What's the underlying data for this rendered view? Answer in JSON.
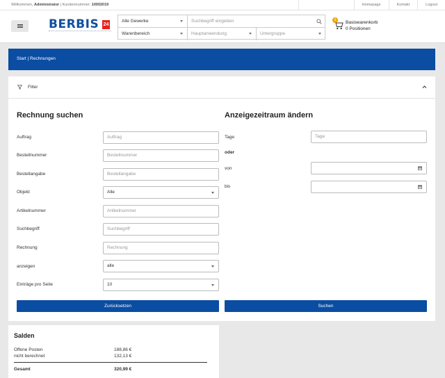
{
  "topbar": {
    "welcome_prefix": "Willkommen,",
    "user": "Administrator",
    "customer_label": "| Kundennummer:",
    "customer_no": "10002019",
    "links": [
      "Homepage",
      "Kontakt",
      "Logout"
    ]
  },
  "header": {
    "logo_text": "BERBIS",
    "logo_badge": "24",
    "search": {
      "trade_select": "Alle Gewerke",
      "search_placeholder": "Suchbegriff eingeben",
      "area_select": "Warenbereich",
      "main_use_select": "Hauptanwendung",
      "subgroup_select": "Untergruppe"
    },
    "cart": {
      "badge": "0",
      "title": "Basiswarenkorb",
      "count": "0 Positionen"
    }
  },
  "breadcrumb": "Start | Rechnungen",
  "filter": {
    "label": "Filter",
    "search_section_title": "Rechnung suchen",
    "period_section_title": "Anzeigezeitraum ändern",
    "fields": [
      {
        "label": "Auftrag",
        "placeholder": "Auftrag",
        "type": "text"
      },
      {
        "label": "Bestellnummer",
        "placeholder": "Bestellnummer",
        "type": "text"
      },
      {
        "label": "Bestellangabe",
        "placeholder": "Bestellangabe",
        "type": "text"
      },
      {
        "label": "Objekt",
        "value": "Alle",
        "type": "select"
      },
      {
        "label": "Artikelnummer",
        "placeholder": "Artikelnummer",
        "type": "text"
      },
      {
        "label": "Suchbegriff",
        "placeholder": "Suchbegriff",
        "type": "text"
      },
      {
        "label": "Rechnung",
        "placeholder": "Rechnung",
        "type": "text"
      },
      {
        "label": "anzeigen",
        "value": "alle",
        "type": "select"
      },
      {
        "label": "Einträge pro Seite",
        "value": "10",
        "type": "select"
      }
    ],
    "period": {
      "days_label": "Tage",
      "days_placeholder": "Tage",
      "or_label": "oder",
      "from_label": "von",
      "to_label": "bis"
    },
    "reset_button": "Zurücksetzen",
    "search_button": "Suchen"
  },
  "salden": {
    "title": "Salden",
    "rows": [
      {
        "label": "Offene Posten",
        "value": "188,86 €"
      },
      {
        "label": "nicht berechnet",
        "value": "132,13 €"
      }
    ],
    "total_label": "Gesamt",
    "total_value": "320,99 €"
  },
  "colors": {
    "primary": "#0a4da2",
    "logo_red": "#e8211d",
    "cart_badge": "#f0a500"
  }
}
